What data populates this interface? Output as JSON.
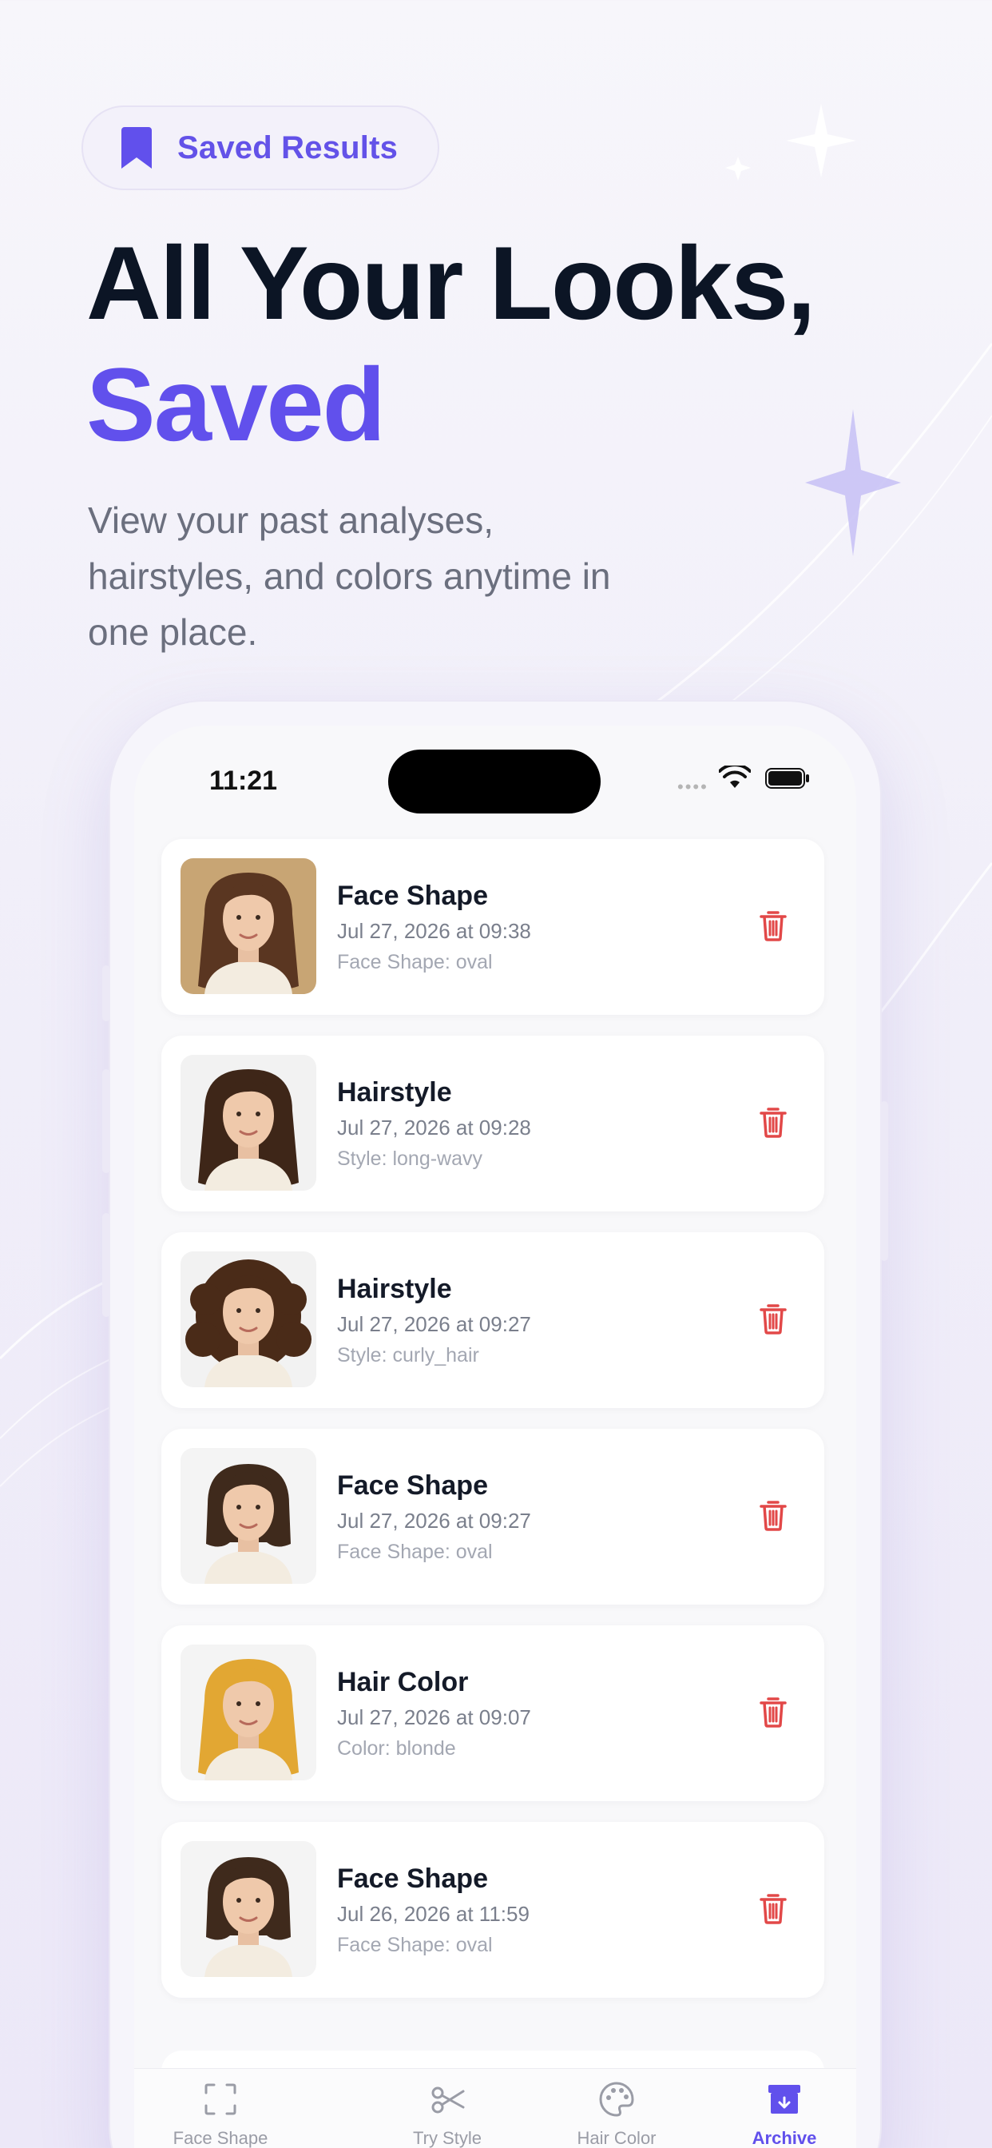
{
  "badge": {
    "label": "Saved Results",
    "icon": "bookmark-icon"
  },
  "headline": {
    "line1": "All Your Looks,",
    "line2": "Saved"
  },
  "subtitle": "View your past analyses, hairstyles, and colors anytime in one place.",
  "colors": {
    "accent": "#6150ec",
    "delete": "#e24848",
    "title": "#0c1525"
  },
  "phone": {
    "status_time": "11:21",
    "items": [
      {
        "title": "Face Shape",
        "date": "Jul 27, 2026 at 09:38",
        "detail": "Face Shape: oval",
        "hair": "brown-wavy"
      },
      {
        "title": "Hairstyle",
        "date": "Jul 27, 2026 at 09:28",
        "detail": "Style: long-wavy",
        "hair": "brown-long-wavy"
      },
      {
        "title": "Hairstyle",
        "date": "Jul 27, 2026 at 09:27",
        "detail": "Style: curly_hair",
        "hair": "brown-curly"
      },
      {
        "title": "Face Shape",
        "date": "Jul 27, 2026 at 09:27",
        "detail": "Face Shape: oval",
        "hair": "brown-bob"
      },
      {
        "title": "Hair Color",
        "date": "Jul 27, 2026 at 09:07",
        "detail": "Color: blonde",
        "hair": "blonde-wavy"
      },
      {
        "title": "Face Shape",
        "date": "Jul 26, 2026 at 11:59",
        "detail": "Face Shape: oval",
        "hair": "brown-bob"
      }
    ],
    "tabs": [
      {
        "label": "Face Shape",
        "icon": "scan-frame-icon",
        "active": false
      },
      {
        "label": "Try Style",
        "icon": "scissors-icon",
        "active": false
      },
      {
        "label": "Hair Color",
        "icon": "palette-icon",
        "active": false
      },
      {
        "label": "Archive",
        "icon": "archive-icon",
        "active": true
      }
    ]
  }
}
